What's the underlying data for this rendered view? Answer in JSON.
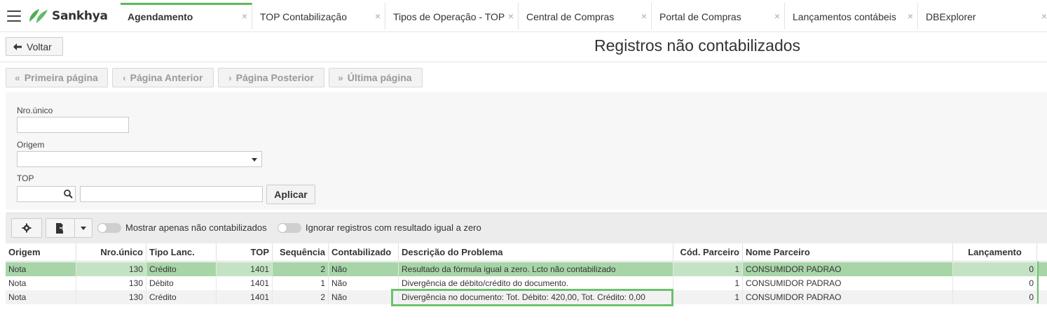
{
  "app": {
    "logo_text": "Sankhya",
    "accent_color": "#5cb85c",
    "tabs": [
      {
        "label": "Agendamento",
        "active": true
      },
      {
        "label": "TOP Contabilização",
        "active": false
      },
      {
        "label": "Tipos de Operação - TOP",
        "active": false
      },
      {
        "label": "Central de Compras",
        "active": false
      },
      {
        "label": "Portal de Compras",
        "active": false
      },
      {
        "label": "Lançamentos contábeis",
        "active": false
      },
      {
        "label": "DBExplorer",
        "active": false
      }
    ],
    "tab_close_glyph": "×"
  },
  "header": {
    "back_label": "Voltar",
    "title": "Registros não contabilizados"
  },
  "pager": {
    "first": "Primeira página",
    "prev": "Página Anterior",
    "next": "Página Posterior",
    "last": "Última página"
  },
  "filters": {
    "nro_unico_label": "Nro.único",
    "nro_unico_value": "",
    "origem_label": "Origem",
    "origem_value": "",
    "top_label": "TOP",
    "top_code_value": "",
    "top_desc_value": "",
    "apply_label": "Aplicar"
  },
  "toolbar": {
    "toggle1_label": "Mostrar apenas não contabilizados",
    "toggle2_label": "Ignorar registros com resultado igual a zero",
    "icons": [
      "gear-icon",
      "export-icon",
      "dropdown-caret-icon"
    ]
  },
  "table": {
    "columns": [
      "Origem",
      "Nro.único",
      "Tipo Lanc.",
      "TOP",
      "Sequência",
      "Contabilizado",
      "Descrição do Problema",
      "Cód. Parceiro",
      "Nome Parceiro",
      "Lançamento"
    ],
    "rows": [
      [
        "Nota",
        "130",
        "Crédito",
        "1401",
        "2",
        "Não",
        "Resultado da fórmula igual a zero. Lcto não contabilizado",
        "1",
        "CONSUMIDOR PADRAO",
        "0"
      ],
      [
        "Nota",
        "130",
        "Débito",
        "1401",
        "1",
        "Não",
        "Divergência de débito/crédito do documento.",
        "1",
        "CONSUMIDOR PADRAO",
        "0"
      ],
      [
        "Nota",
        "130",
        "Crédito",
        "1401",
        "2",
        "Não",
        "Divergência no documento: Tot. Débito: 420,00, Tot. Crédito: 0,00",
        "1",
        "CONSUMIDOR PADRAO",
        "0"
      ]
    ],
    "selected_row": 0
  }
}
